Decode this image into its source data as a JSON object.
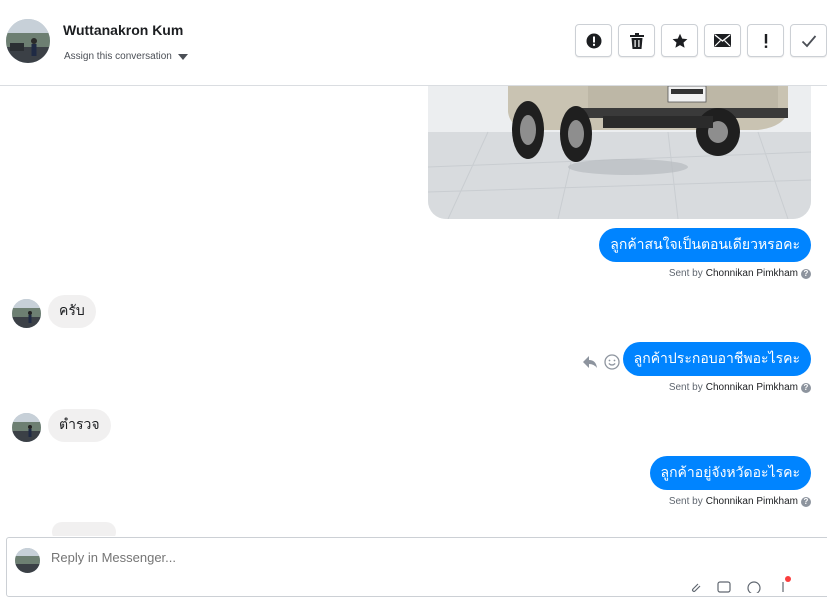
{
  "header": {
    "contact_name": "Wuttanakron Kum",
    "assign_label": "Assign this conversation",
    "actions": [
      {
        "name": "mark-spam-button",
        "icon": "alert-circle-icon"
      },
      {
        "name": "delete-button",
        "icon": "trash-icon"
      },
      {
        "name": "star-button",
        "icon": "star-icon"
      },
      {
        "name": "mark-unread-button",
        "icon": "envelope-icon"
      },
      {
        "name": "follow-up-button",
        "icon": "exclamation-icon"
      },
      {
        "name": "mark-done-button",
        "icon": "checkmark-icon"
      }
    ]
  },
  "thread": {
    "messages": [
      {
        "direction": "out",
        "type": "image",
        "description_icon": "car-photo"
      },
      {
        "direction": "out",
        "text": "ลูกค้าสนใจเป็นตอนเดียวหรอคะ",
        "sent_by_prefix": "Sent by",
        "sent_by_name": "Chonnikan Pimkham"
      },
      {
        "direction": "in",
        "text": "ครับ"
      },
      {
        "direction": "out",
        "text": "ลูกค้าประกอบอาชีพอะไรคะ",
        "sent_by_prefix": "Sent by",
        "sent_by_name": "Chonnikan Pimkham"
      },
      {
        "direction": "in",
        "text": "ตำรวจ"
      },
      {
        "direction": "out",
        "text": "ลูกค้าอยู่จังหวัดอะไรคะ",
        "sent_by_prefix": "Sent by",
        "sent_by_name": "Chonnikan Pimkham"
      }
    ]
  },
  "composer": {
    "placeholder": "Reply in Messenger..."
  },
  "colors": {
    "outgoing_bubble": "#0084ff",
    "incoming_bubble": "#f1f0f0",
    "border": "#dadde1"
  }
}
